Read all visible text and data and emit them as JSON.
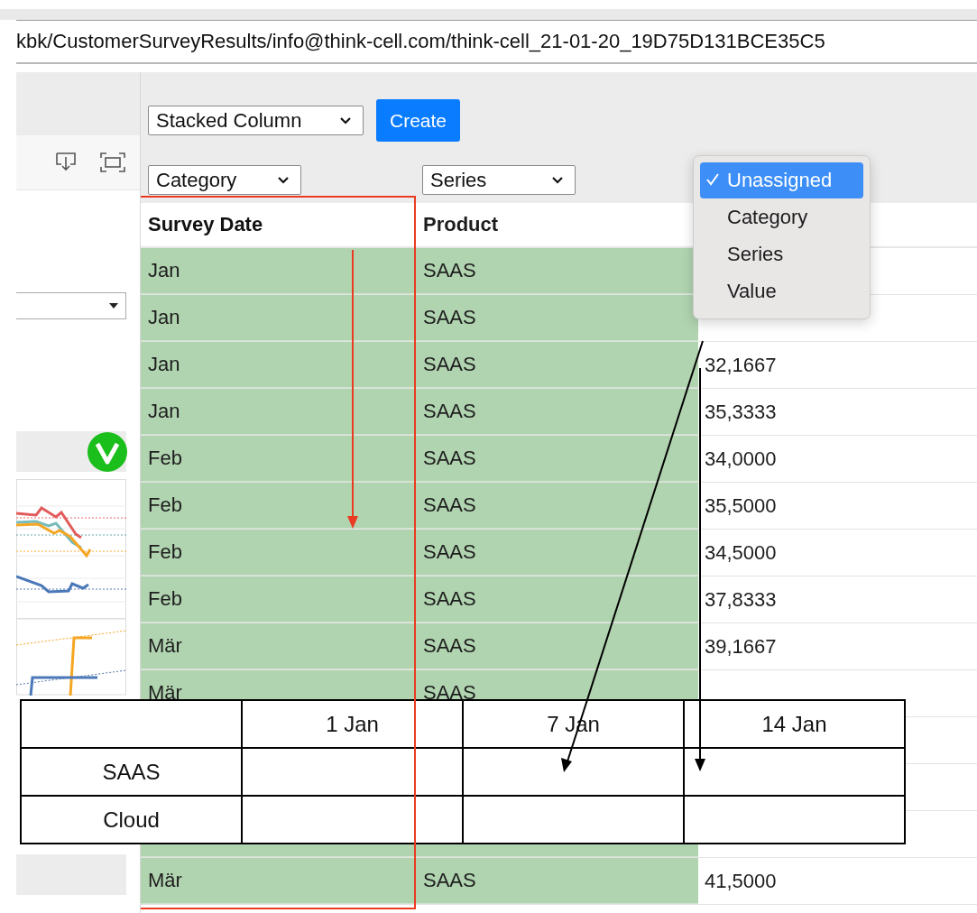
{
  "address_bar": {
    "url": "kbk/CustomerSurveyResults/info@think-cell.com/think-cell_21-01-20_19D75D131BCE35C5"
  },
  "toolbar": {
    "chart_type": "Stacked Column",
    "create_button": "Create"
  },
  "column_roles": [
    {
      "value": "Category"
    },
    {
      "value": "Series"
    }
  ],
  "role_menu": {
    "items": [
      {
        "label": "Unassigned",
        "selected": true
      },
      {
        "label": "Category",
        "selected": false
      },
      {
        "label": "Series",
        "selected": false
      },
      {
        "label": "Value",
        "selected": false
      }
    ]
  },
  "table": {
    "columns": [
      {
        "label": "Survey Date",
        "highlighted": true
      },
      {
        "label": "Product",
        "highlighted": false
      }
    ],
    "rows": [
      {
        "survey_date": "Jan",
        "product": "SAAS"
      },
      {
        "survey_date": "Jan",
        "product": "SAAS"
      },
      {
        "survey_date": "Jan",
        "product": "SAAS",
        "value": "32,1667"
      },
      {
        "survey_date": "Jan",
        "product": "SAAS",
        "value": "35,3333"
      },
      {
        "survey_date": "Feb",
        "product": "SAAS",
        "value": "34,0000"
      },
      {
        "survey_date": "Feb",
        "product": "SAAS",
        "value": "35,5000"
      },
      {
        "survey_date": "Feb",
        "product": "SAAS",
        "value": "34,5000"
      },
      {
        "survey_date": "Feb",
        "product": "SAAS",
        "value": "37,8333"
      },
      {
        "survey_date": "Mär",
        "product": "SAAS",
        "value": "39,1667"
      },
      {
        "survey_date": "Mär",
        "product": "SAAS"
      }
    ],
    "rows_below": [
      {
        "survey_date": "Mär",
        "product": "SAAS",
        "value": "41,5000"
      }
    ]
  },
  "target_table": {
    "columns": [
      "1 Jan",
      "7 Jan",
      "14 Jan"
    ],
    "rows": [
      "SAAS",
      "Cloud"
    ]
  }
}
